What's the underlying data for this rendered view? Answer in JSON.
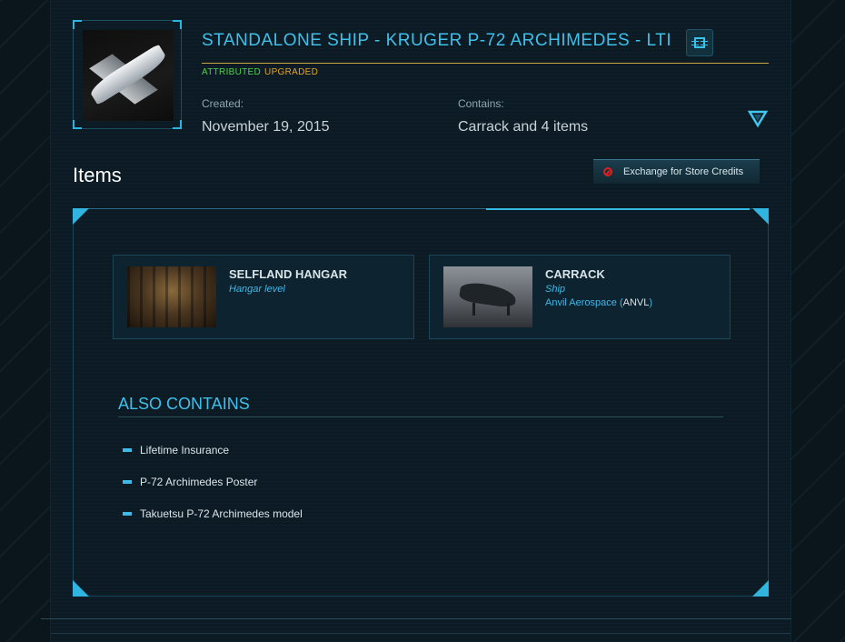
{
  "product": {
    "title": "STANDALONE SHIP - KRUGER P-72 ARCHIMEDES - LTI",
    "badges": {
      "attributed": "ATTRIBUTED",
      "upgraded": "UPGRADED"
    },
    "created_label": "Created:",
    "created_value": "November 19, 2015",
    "contains_label": "Contains:",
    "contains_value": "Carrack and 4 items"
  },
  "items_section": {
    "heading": "Items",
    "exchange_button": "Exchange for Store Credits",
    "cards": [
      {
        "name": "SELFLAND HANGAR",
        "type": "Hangar level"
      },
      {
        "name": "CARRACK",
        "type": "Ship",
        "manufacturer": "Anvil Aerospace",
        "manufacturer_code_open": "(",
        "manufacturer_code": "ANVL",
        "manufacturer_code_close": ")"
      }
    ]
  },
  "also_contains": {
    "heading": "ALSO CONTAINS",
    "items": [
      "Lifetime Insurance",
      "P-72 Archimedes Poster",
      "Takuetsu P-72 Archimedes model"
    ]
  },
  "colors": {
    "accent": "#3fc0ea",
    "gold_rule": "#c9a540",
    "attributed": "#4fd14a",
    "upgraded": "#e3a52b",
    "danger": "#e02020"
  },
  "icons": {
    "upgrade": "chip-icon",
    "expand": "triangle-down-icon",
    "exchange": "no-entry-icon"
  }
}
